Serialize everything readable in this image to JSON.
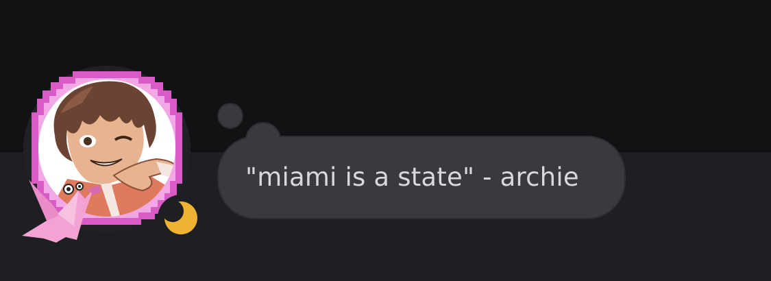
{
  "profile": {
    "avatar_icon": "anime-avatar-icon",
    "decoration_icon": "pixel-frame-icon",
    "paper_crane_icon": "paper-crane-icon",
    "status": {
      "name": "idle",
      "icon": "moon-icon",
      "color": "#f0b232"
    },
    "frame_color": "#d85bc6"
  },
  "custom_status": {
    "text": "\"miami is a state\" - archie"
  },
  "colors": {
    "background_top": "#111214",
    "background_bottom": "#1e1f22",
    "bubble": "#383a40",
    "text": "#d7d9dc"
  }
}
